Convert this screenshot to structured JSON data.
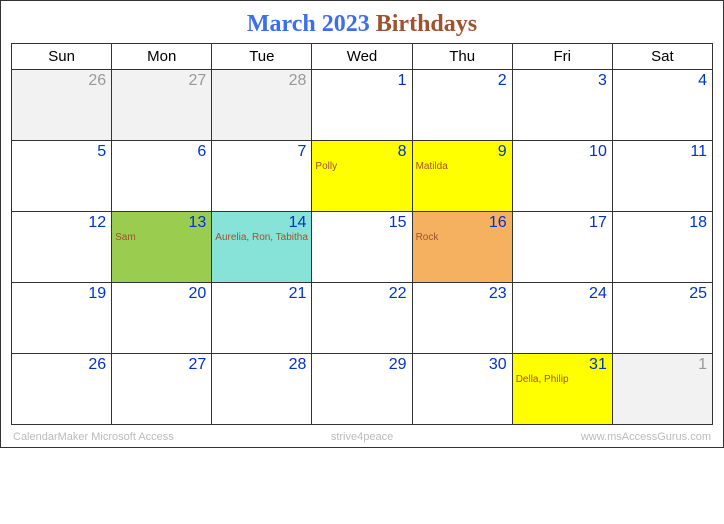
{
  "title": {
    "month": "March 2023",
    "suffix": "Birthdays"
  },
  "weekdays": [
    "Sun",
    "Mon",
    "Tue",
    "Wed",
    "Thu",
    "Fri",
    "Sat"
  ],
  "days": [
    {
      "num": "26",
      "type": "prev"
    },
    {
      "num": "27",
      "type": "prev"
    },
    {
      "num": "28",
      "type": "prev"
    },
    {
      "num": "1",
      "type": "cur"
    },
    {
      "num": "2",
      "type": "cur"
    },
    {
      "num": "3",
      "type": "cur"
    },
    {
      "num": "4",
      "type": "cur"
    },
    {
      "num": "5",
      "type": "cur"
    },
    {
      "num": "6",
      "type": "cur"
    },
    {
      "num": "7",
      "type": "cur"
    },
    {
      "num": "8",
      "type": "cur",
      "bg": "bg-yellow",
      "event": "Polly"
    },
    {
      "num": "9",
      "type": "cur",
      "bg": "bg-yellow",
      "event": "Matilda"
    },
    {
      "num": "10",
      "type": "cur"
    },
    {
      "num": "11",
      "type": "cur"
    },
    {
      "num": "12",
      "type": "cur"
    },
    {
      "num": "13",
      "type": "cur",
      "bg": "bg-green",
      "event": "Sam"
    },
    {
      "num": "14",
      "type": "cur",
      "bg": "bg-cyan",
      "event": "Aurelia, Ron, Tabitha"
    },
    {
      "num": "15",
      "type": "cur"
    },
    {
      "num": "16",
      "type": "cur",
      "bg": "bg-orange",
      "event": "Rock"
    },
    {
      "num": "17",
      "type": "cur"
    },
    {
      "num": "18",
      "type": "cur"
    },
    {
      "num": "19",
      "type": "cur"
    },
    {
      "num": "20",
      "type": "cur"
    },
    {
      "num": "21",
      "type": "cur"
    },
    {
      "num": "22",
      "type": "cur"
    },
    {
      "num": "23",
      "type": "cur"
    },
    {
      "num": "24",
      "type": "cur"
    },
    {
      "num": "25",
      "type": "cur"
    },
    {
      "num": "26",
      "type": "cur"
    },
    {
      "num": "27",
      "type": "cur"
    },
    {
      "num": "28",
      "type": "cur"
    },
    {
      "num": "29",
      "type": "cur"
    },
    {
      "num": "30",
      "type": "cur"
    },
    {
      "num": "31",
      "type": "cur",
      "bg": "bg-yellow",
      "event": "Della, Philip"
    },
    {
      "num": "1",
      "type": "next"
    }
  ],
  "footer": {
    "left": "CalendarMaker   Microsoft Access",
    "center": "strive4peace",
    "right": "www.msAccessGurus.com"
  }
}
